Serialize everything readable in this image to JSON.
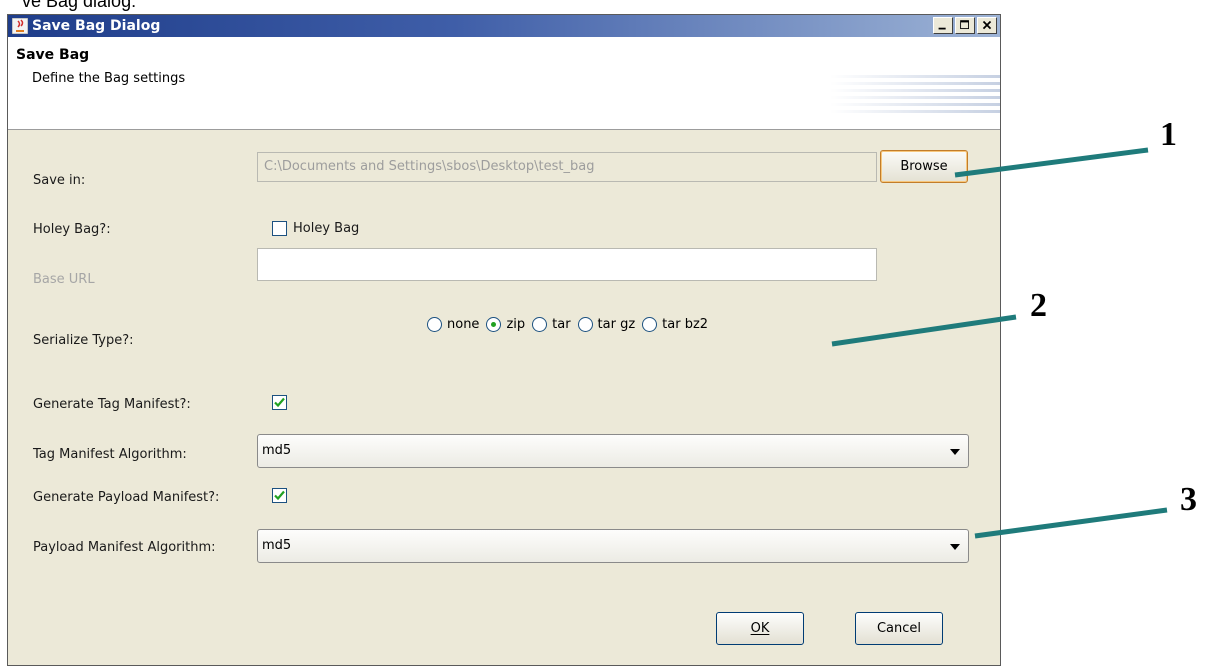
{
  "top_text": "ve Bag dialog:",
  "window": {
    "title": "Save Bag Dialog",
    "buttons": [
      "minimize-icon",
      "maximize-icon",
      "close-icon"
    ]
  },
  "header": {
    "title": "Save Bag",
    "description": "Define the Bag settings"
  },
  "form": {
    "save_in_label": "Save in:",
    "save_in_value": "C:\\Documents and Settings\\sbos\\Desktop\\test_bag",
    "browse_label": "Browse",
    "holey_label": "Holey Bag?:",
    "holey_checkbox_label": "Holey Bag",
    "holey_checked": false,
    "base_url_label": "Base URL",
    "base_url_value": "",
    "serialize_label": "Serialize Type?:",
    "serialize_options": [
      "none",
      "zip",
      "tar",
      "tar gz",
      "tar bz2"
    ],
    "serialize_selected": "zip",
    "gen_tag_label": "Generate Tag Manifest?:",
    "gen_tag_checked": true,
    "tag_alg_label": "Tag Manifest Algorithm:",
    "tag_alg_value": "md5",
    "gen_payload_label": "Generate Payload Manifest?:",
    "gen_payload_checked": true,
    "payload_alg_label": "Payload Manifest Algorithm:",
    "payload_alg_value": "md5"
  },
  "footer": {
    "ok_label": "OK",
    "cancel_label": "Cancel"
  },
  "annotations": [
    {
      "label": "1"
    },
    {
      "label": "2"
    },
    {
      "label": "3"
    }
  ],
  "colors": {
    "annotation_line": "#1f7b7b",
    "radio_selected": "#21a121",
    "checkmark": "#21a121",
    "browse_focus_border": "#c27d2a"
  }
}
